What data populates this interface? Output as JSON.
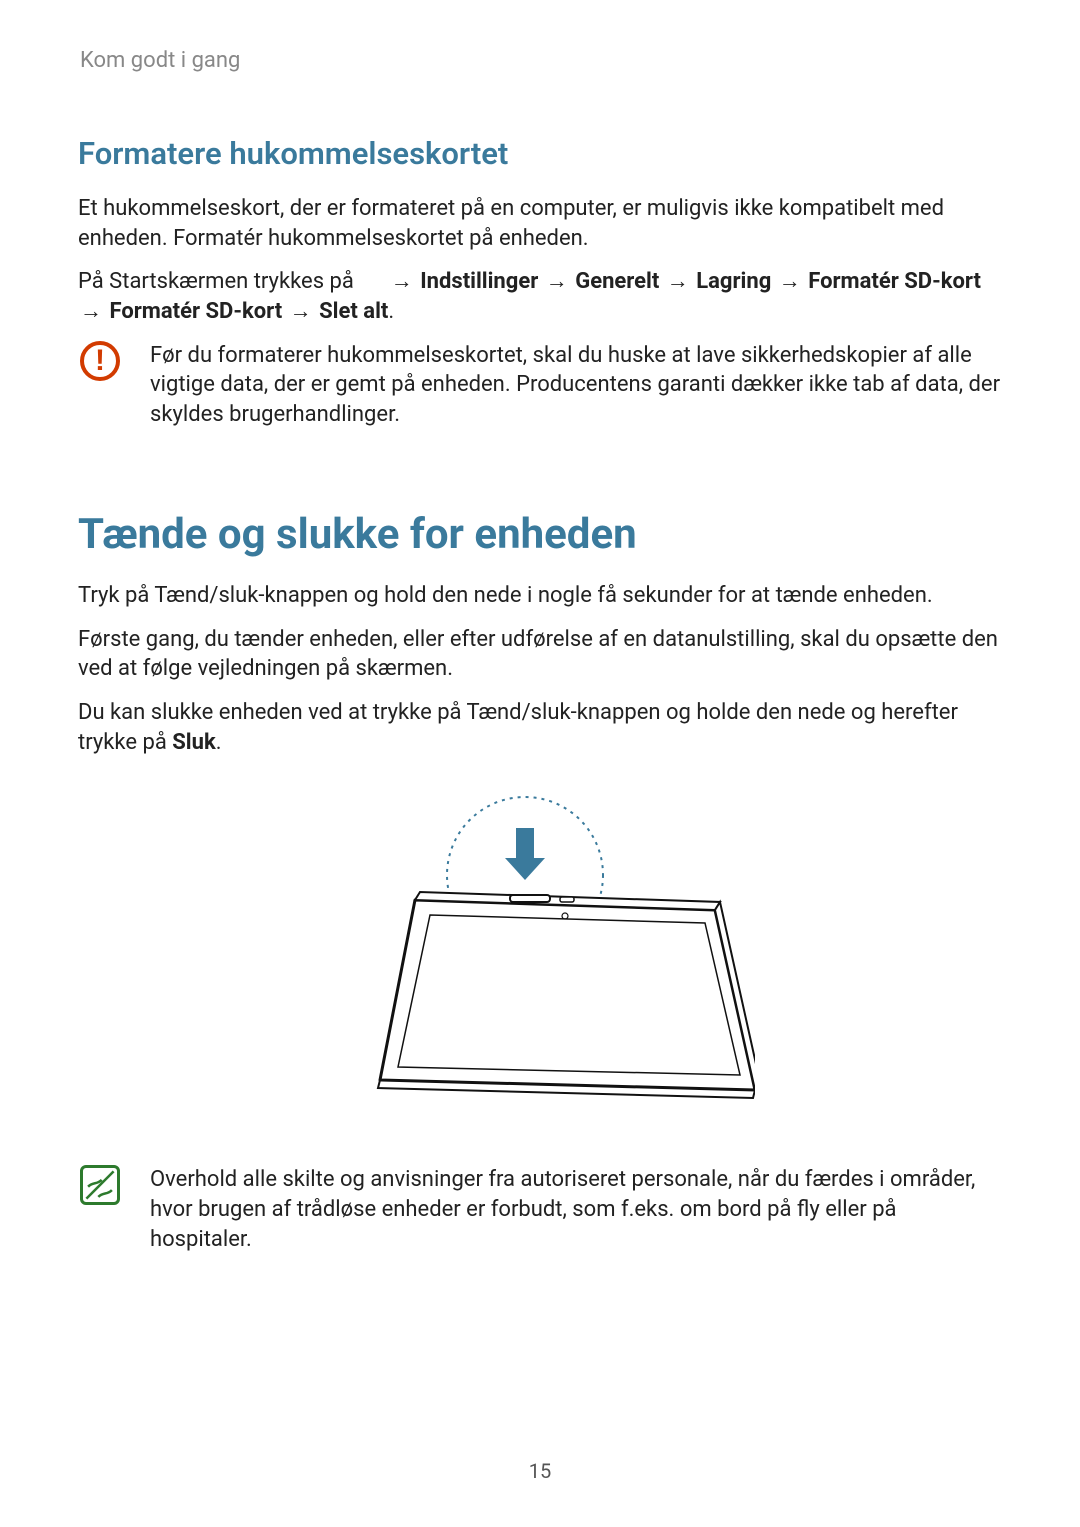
{
  "breadcrumb": "Kom godt i gang",
  "section1": {
    "heading": "Formatere hukommelseskortet",
    "p1": "Et hukommelseskort, der er formateret på en computer, er muligvis ikke kompatibelt med enheden. Formatér hukommelseskortet på enheden.",
    "p2_prefix": "På Startskærmen trykkes på ",
    "p2_path_items": [
      "Indstillinger",
      "Generelt",
      "Lagring",
      "Formatér SD-kort",
      "Formatér SD-kort",
      "Slet alt"
    ],
    "p2_arrow": "→",
    "warning_text": "Før du formaterer hukommelseskortet, skal du huske at lave sikkerhedskopier af alle vigtige data, der er gemt på enheden. Producentens garanti dækker ikke tab af data, der skyldes brugerhandlinger."
  },
  "section2": {
    "heading": "Tænde og slukke for enheden",
    "p1": "Tryk på Tænd/sluk-knappen og hold den nede i nogle få sekunder for at tænde enheden.",
    "p2": "Første gang, du tænder enheden, eller efter udførelse af en datanulstilling, skal du opsætte den ved at følge vejledningen på skærmen.",
    "p3_prefix": "Du kan slukke enheden ved at trykke på Tænd/sluk-knappen og holde den nede og herefter trykke på ",
    "p3_bold": "Sluk",
    "p3_suffix": ".",
    "note_text": "Overhold alle skilte og anvisninger fra autoriseret personale, når du færdes i områder, hvor brugen af trådløse enheder er forbudt, som f.eks. om bord på fly eller på hospitaler."
  },
  "page_number": "15"
}
